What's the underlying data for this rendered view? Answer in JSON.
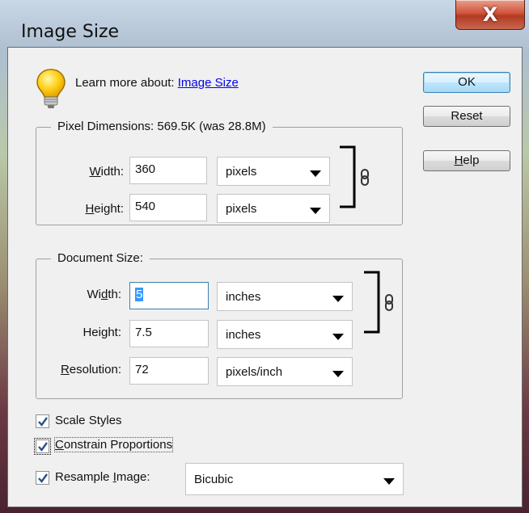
{
  "window": {
    "title": "Image Size",
    "close_glyph": "X"
  },
  "tip": {
    "prefix": "Learn more about: ",
    "link": "Image Size"
  },
  "buttons": {
    "ok": "OK",
    "reset": "Reset",
    "help_pre": "",
    "help_u": "H",
    "help_post": "elp"
  },
  "pixel_dimensions": {
    "label": "Pixel Dimensions:  569.5K (was 28.8M)",
    "width": {
      "u": "W",
      "rest": "idth:",
      "value": "360",
      "unit": "pixels"
    },
    "height": {
      "u": "H",
      "rest": "eight:",
      "value": "540",
      "unit": "pixels"
    }
  },
  "document_size": {
    "label": "Document Size:",
    "width": {
      "pre": "Wi",
      "u": "d",
      "post": "th:",
      "value": "5",
      "unit": "inches"
    },
    "height": {
      "pre": "Hei",
      "u": "g",
      "post": "ht:",
      "value": "7.5",
      "unit": "inches"
    },
    "resolution": {
      "u": "R",
      "rest": "esolution:",
      "value": "72",
      "unit": "pixels/inch"
    }
  },
  "options": {
    "scale_styles": {
      "label": "Scale Styles",
      "checked": true
    },
    "constrain": {
      "u": "C",
      "rest": "onstrain Proportions",
      "checked": true
    },
    "resample": {
      "pre": "Resample ",
      "u": "I",
      "post": "mage:",
      "checked": true,
      "method": "Bicubic"
    }
  }
}
